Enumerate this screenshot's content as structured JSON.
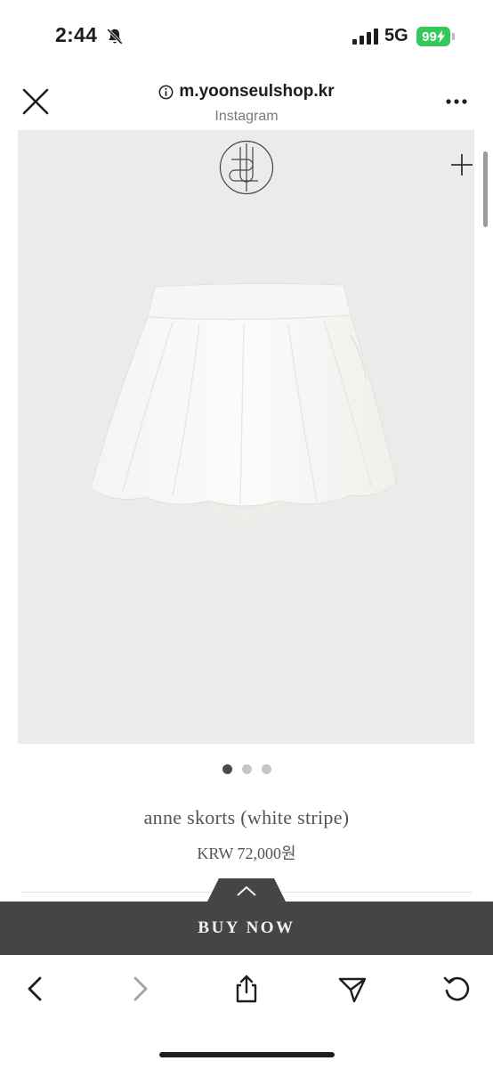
{
  "status_bar": {
    "time": "2:44",
    "network": "5G",
    "battery": "99"
  },
  "browser": {
    "url": "m.yoonseulshop.kr",
    "source": "Instagram"
  },
  "gallery": {
    "slide_count": 3,
    "active_slide": 1
  },
  "product": {
    "name": "anne skorts (white stripe)",
    "price": "KRW 72,000원"
  },
  "actions": {
    "buy_label": "BUY NOW"
  },
  "icons": {
    "status": [
      "bell-slash-icon",
      "signal-icon"
    ],
    "header": [
      "close-icon",
      "info-icon",
      "more-icon"
    ],
    "image": [
      "brand-logo",
      "plus-icon"
    ],
    "toolbar": [
      "back-icon",
      "forward-icon",
      "share-icon",
      "send-icon",
      "reload-icon"
    ]
  },
  "colors": {
    "battery": "#34c759",
    "buy_bar": "#454545",
    "image_bg": "#ebebea"
  }
}
